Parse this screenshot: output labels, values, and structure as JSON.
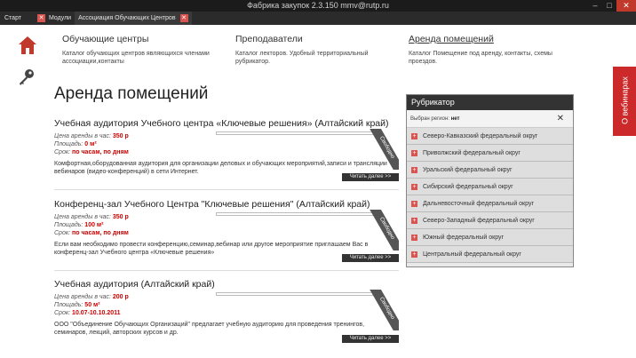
{
  "window": {
    "title": "Фабрика закупок 2.3.150 mmv@rutp.ru",
    "controls": [
      "–",
      "□",
      "✕"
    ]
  },
  "tabs": {
    "start": "Старт",
    "items": [
      {
        "label": "Модули"
      },
      {
        "label": "Ассоциация Обучающих Центров"
      }
    ]
  },
  "categories": [
    {
      "title": "Обучающие центры",
      "desc": "Каталог обучающих центров являющихся членами ассоциации,контакты"
    },
    {
      "title": "Преподаватели",
      "desc": "Каталог лекторов. Удобный территориальный рубрикатор."
    },
    {
      "title": "Аренда помещений",
      "desc": "Каталог Помещение под аренду, контакты, схемы проездов."
    }
  ],
  "page_title": "Аренда помещений",
  "listings": [
    {
      "title": "Учебная аудитория Учебного центра «Ключевые решения» (Алтайский край)",
      "price_label": "Цена аренды в час:",
      "price": "350 р",
      "area_label": "Площадь:",
      "area": "0 м²",
      "term_label": "Срок:",
      "term": "по часам, по дням",
      "desc": "Комфортная,оборудованная аудитория для организации деловых и обучающих мероприятий,записи и трансляции вебинаров (видео-конференций) в сети Интернет.",
      "more": "Читать далее >>",
      "ribbon": "Свободно"
    },
    {
      "title": "Конференц-зал Учебного Центра \"Ключевые решения\" (Алтайский край)",
      "price_label": "Цена аренды в час:",
      "price": "350 р",
      "area_label": "Площадь:",
      "area": "100 м²",
      "term_label": "Срок:",
      "term": "по часам, по дням",
      "desc": "Если вам необходимо провести конференцию,семинар,вебинар или другое мероприятие приглашаем Вас в конференц-зал Учебного центра «Ключевые решения»",
      "more": "Читать далее >>",
      "ribbon": "Свободно"
    },
    {
      "title": "Учебная аудитория (Алтайский край)",
      "price_label": "Цена аренды в час:",
      "price": "200 р",
      "area_label": "Площадь:",
      "area": "50 м²",
      "term_label": "Срок:",
      "term": "10.07-10.10.2011",
      "desc": "ООО \"Объединение Обучающих Организаций\" предлагает учебную аудиторию для проведения тренингов, семинаров, лекций, авторских курсов и др.",
      "more": "Читать далее >>",
      "ribbon": "Свободно"
    }
  ],
  "rubricator": {
    "title": "Рубрикатор",
    "selected_label": "Выбран регион:",
    "selected_value": "нет",
    "clear": "✕",
    "items": [
      "Северо-Кавказский федеральный округ",
      "Приволжский федеральный округ",
      "Уральский федеральный округ",
      "Сибирский федеральный округ",
      "Дальневосточный федеральный округ",
      "Северо-Западный федеральный округ",
      "Южный федеральный округ",
      "Центральный федеральный округ"
    ]
  },
  "webinar_tab": "О вебинарах",
  "colors": {
    "accent": "#cc2a2a",
    "dark": "#333333"
  }
}
